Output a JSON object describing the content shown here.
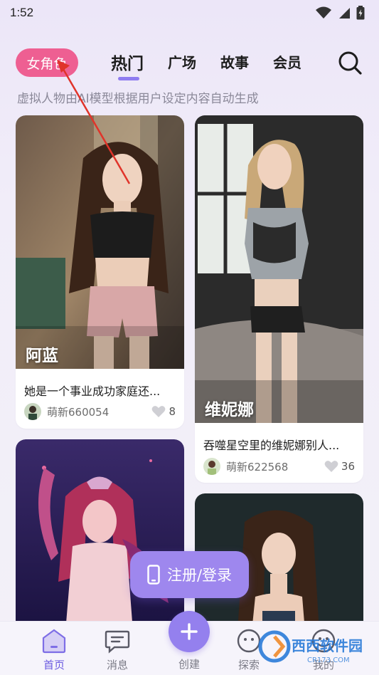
{
  "status_bar": {
    "time": "1:52"
  },
  "top_nav": {
    "role_pill": "女角色",
    "tabs": [
      {
        "label": "热门",
        "active": true
      },
      {
        "label": "广场",
        "active": false
      },
      {
        "label": "故事",
        "active": false
      },
      {
        "label": "会员",
        "active": false
      }
    ]
  },
  "subtitle": "虚拟人物由AI模型根据用户设定内容自动生成",
  "cards": [
    {
      "name": "阿蓝",
      "description": "她是一个事业成功家庭还...",
      "username": "萌新660054",
      "likes": "8"
    },
    {
      "name": "维妮娜",
      "description": "吞噬星空里的维妮娜别人...",
      "username": "萌新622568",
      "likes": "36"
    }
  ],
  "login_button": "注册/登录",
  "bottom_nav": {
    "items": [
      {
        "label": "首页",
        "icon": "home-icon",
        "active": true
      },
      {
        "label": "消息",
        "icon": "message-icon",
        "active": false
      },
      {
        "label": "创建",
        "icon": "plus-icon",
        "active": false
      },
      {
        "label": "探索",
        "icon": "explore-icon",
        "active": false
      },
      {
        "label": "我的",
        "icon": "profile-icon",
        "active": false
      }
    ]
  },
  "watermark": {
    "text": "西西软件园",
    "subtext": "CR173.COM"
  },
  "colors": {
    "accent": "#8f7cf0",
    "pill": "#ee5f92",
    "annotation_arrow": "#e0342a"
  }
}
